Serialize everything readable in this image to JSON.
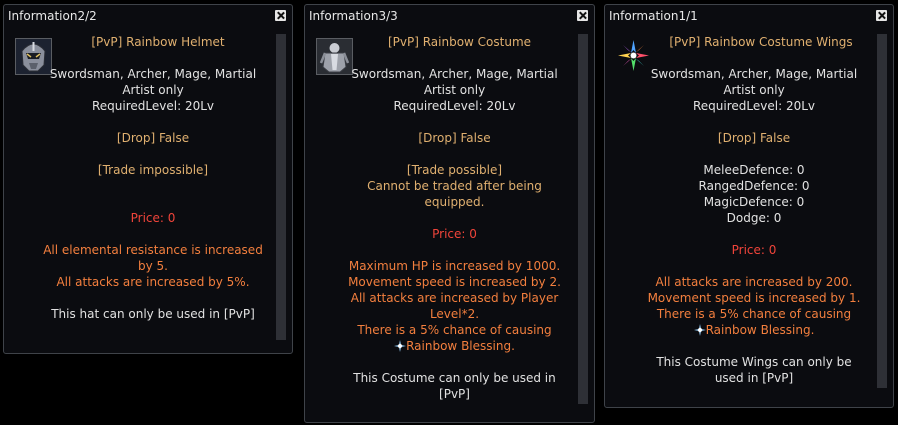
{
  "panels": [
    {
      "title": "Information2/2",
      "item_name": "[PvP] Rainbow Helmet",
      "icon": "helmet-icon",
      "req_lines": [
        "Swordsman, Archer, Mage, Martial",
        "Artist only",
        "RequiredLevel: 20Lv"
      ],
      "drop": "[Drop] False",
      "trade": "[Trade impossible]",
      "price": "Price: 0",
      "effects": [
        "All elemental resistance is increased",
        "by 5.",
        "All attacks are increased by 5%."
      ],
      "usage": [
        "This hat can only be used in [PvP]"
      ]
    },
    {
      "title": "Information3/3",
      "item_name": "[PvP] Rainbow Costume",
      "icon": "costume-icon",
      "req_lines": [
        "Swordsman, Archer, Mage, Martial",
        "Artist only",
        "RequiredLevel: 20Lv"
      ],
      "drop": "[Drop] False",
      "trade": "[Trade possible]",
      "trade_note": [
        "Cannot be traded after being",
        "equipped."
      ],
      "price": "Price: 0",
      "effects": [
        "Maximum HP is increased by 1000.",
        "Movement speed is increased by 2.",
        "All attacks are increased by Player",
        "Level*2.",
        "There is a 5% chance of causing"
      ],
      "blessing": "Rainbow Blessing.",
      "usage": [
        "This Costume can only be used in",
        "[PvP]"
      ]
    },
    {
      "title": "Information1/1",
      "item_name": "[PvP] Rainbow Costume Wings",
      "icon": "wings-icon",
      "req_lines": [
        "Swordsman, Archer, Mage, Martial",
        "Artist only",
        "RequiredLevel: 20Lv"
      ],
      "drop": "[Drop] False",
      "defences": [
        "MeleeDefence: 0",
        "RangedDefence: 0",
        "MagicDefence: 0",
        "Dodge: 0"
      ],
      "price": "Price: 0",
      "effects": [
        "All attacks are increased by 200.",
        "Movement speed is increased by 1.",
        "There is a 5% chance of causing"
      ],
      "blessing": "Rainbow Blessing.",
      "usage": [
        "This Costume Wings can only be",
        "used in [PvP]"
      ]
    }
  ],
  "colors": {
    "item_name": "#e0b070",
    "effect": "#f37f3e",
    "price": "#f0443a",
    "text": "#e2e2e2"
  }
}
